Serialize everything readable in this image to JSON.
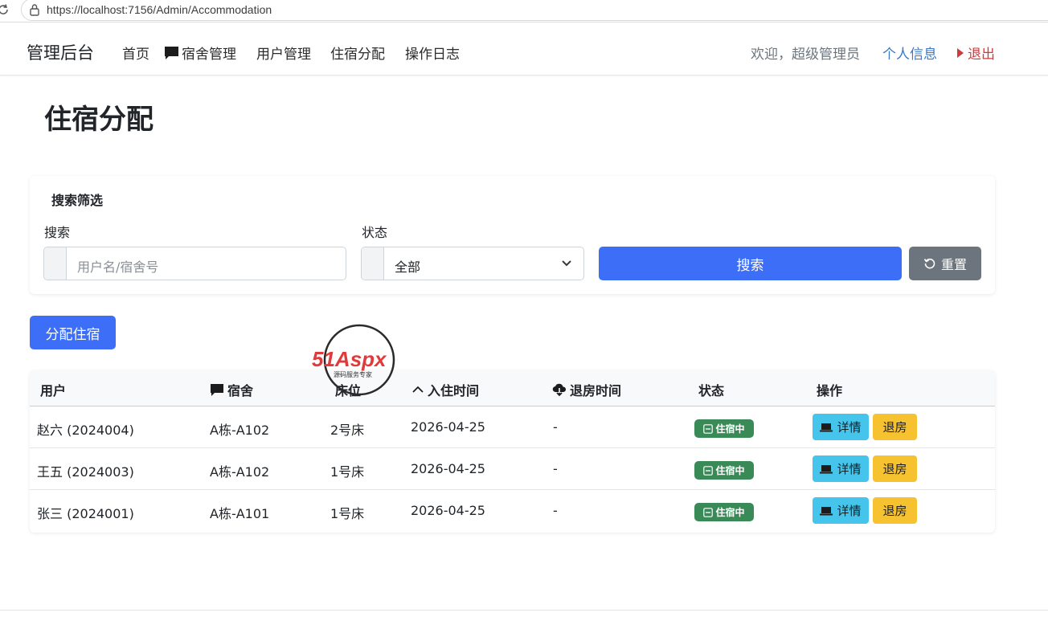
{
  "browser": {
    "url": "https://localhost:7156/Admin/Accommodation"
  },
  "navbar": {
    "brand": "管理后台",
    "items": [
      {
        "label": "首页"
      },
      {
        "label": "宿舍管理"
      },
      {
        "label": "用户管理"
      },
      {
        "label": "住宿分配"
      },
      {
        "label": "操作日志"
      }
    ],
    "welcome": "欢迎，超级管理员",
    "profile": "个人信息",
    "logout": "退出"
  },
  "page": {
    "title": "住宿分配"
  },
  "filter": {
    "title": "搜索筛选",
    "search_label": "搜索",
    "search_placeholder": "用户名/宿舍号",
    "status_label": "状态",
    "status_selected": "全部",
    "search_button": "搜索",
    "reset_button": "重置"
  },
  "actions": {
    "assign_button": "分配住宿"
  },
  "watermark": {
    "brand": "51Aspx",
    "slogan": "源码服务专家"
  },
  "table": {
    "headers": {
      "user": "用户",
      "dorm": "宿舍",
      "bed": "床位",
      "checkin": "入住时间",
      "checkout": "退房时间",
      "status": "状态",
      "ops": "操作"
    },
    "rows": [
      {
        "user": "赵六 (2024004)",
        "dorm": "A栋-A102",
        "bed": "2号床",
        "checkin": "2026-04-25",
        "checkout": "-",
        "status": "住宿中",
        "detail": "详情",
        "checkout_btn": "退房"
      },
      {
        "user": "王五 (2024003)",
        "dorm": "A栋-A102",
        "bed": "1号床",
        "checkin": "2026-04-25",
        "checkout": "-",
        "status": "住宿中",
        "detail": "详情",
        "checkout_btn": "退房"
      },
      {
        "user": "张三 (2024001)",
        "dorm": "A栋-A101",
        "bed": "1号床",
        "checkin": "2026-04-25",
        "checkout": "-",
        "status": "住宿中",
        "detail": "详情",
        "checkout_btn": "退房"
      }
    ]
  },
  "colors": {
    "primary": "#3d6ef7",
    "secondary": "#6c757d",
    "info": "#45c4ec",
    "warning": "#f6c230",
    "success": "#3a8a58",
    "danger": "#d03a3a",
    "link": "#3a78c9"
  }
}
